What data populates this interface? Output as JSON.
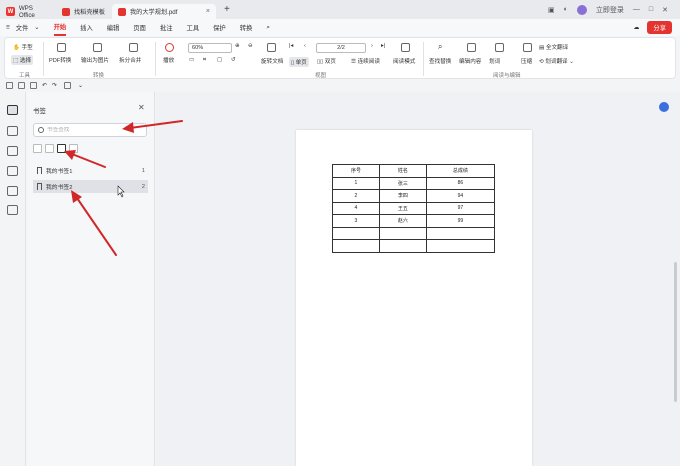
{
  "tabs": [
    {
      "label": "WPS Office"
    },
    {
      "label": "找稻壳模板"
    },
    {
      "label": "我的大学规划.pdf"
    }
  ],
  "account": {
    "label": "立即登录"
  },
  "menu": {
    "file": "文件",
    "items": [
      "开始",
      "插入",
      "编辑",
      "页面",
      "批注",
      "工具",
      "保护",
      "转换"
    ],
    "active": "开始",
    "share": "分享"
  },
  "ribbon": {
    "hand": "手型",
    "select": "选择",
    "tools_group": "工具",
    "pdf_convert": "PDF转换",
    "export_image": "输出为图片",
    "split_merge": "拆分合并",
    "convert_group": "转换",
    "play": "播放",
    "zoom": "60%",
    "rotate_doc": "旋转文档",
    "single_page": "单页",
    "double_page": "双页",
    "continuous": "连续阅读",
    "reading_mode": "阅读模式",
    "view_group": "视图",
    "page_indicator": "2/2",
    "find_replace": "查找替换",
    "edit_content": "编辑内容",
    "highlight": "划词",
    "translate_full": "全文翻译",
    "compress": "压缩",
    "translate_word": "划词翻译",
    "read_edit_group": "阅读与编辑"
  },
  "bookmark_panel": {
    "title": "书签",
    "search_placeholder": "书签查找",
    "items": [
      {
        "label": "我的书签1",
        "page": "1"
      },
      {
        "label": "我的书签2",
        "page": "2"
      }
    ]
  },
  "document": {
    "headers": [
      "序号",
      "姓名",
      "总成绩"
    ],
    "rows": [
      [
        "1",
        "张三",
        "86"
      ],
      [
        "2",
        "李四",
        "94"
      ],
      [
        "4",
        "王五",
        "97"
      ],
      [
        "3",
        "赵六",
        "99"
      ],
      [
        "",
        "",
        ""
      ],
      [
        "",
        "",
        ""
      ]
    ]
  },
  "colors": {
    "accent": "#e3342f",
    "arrow": "#d0282a"
  }
}
